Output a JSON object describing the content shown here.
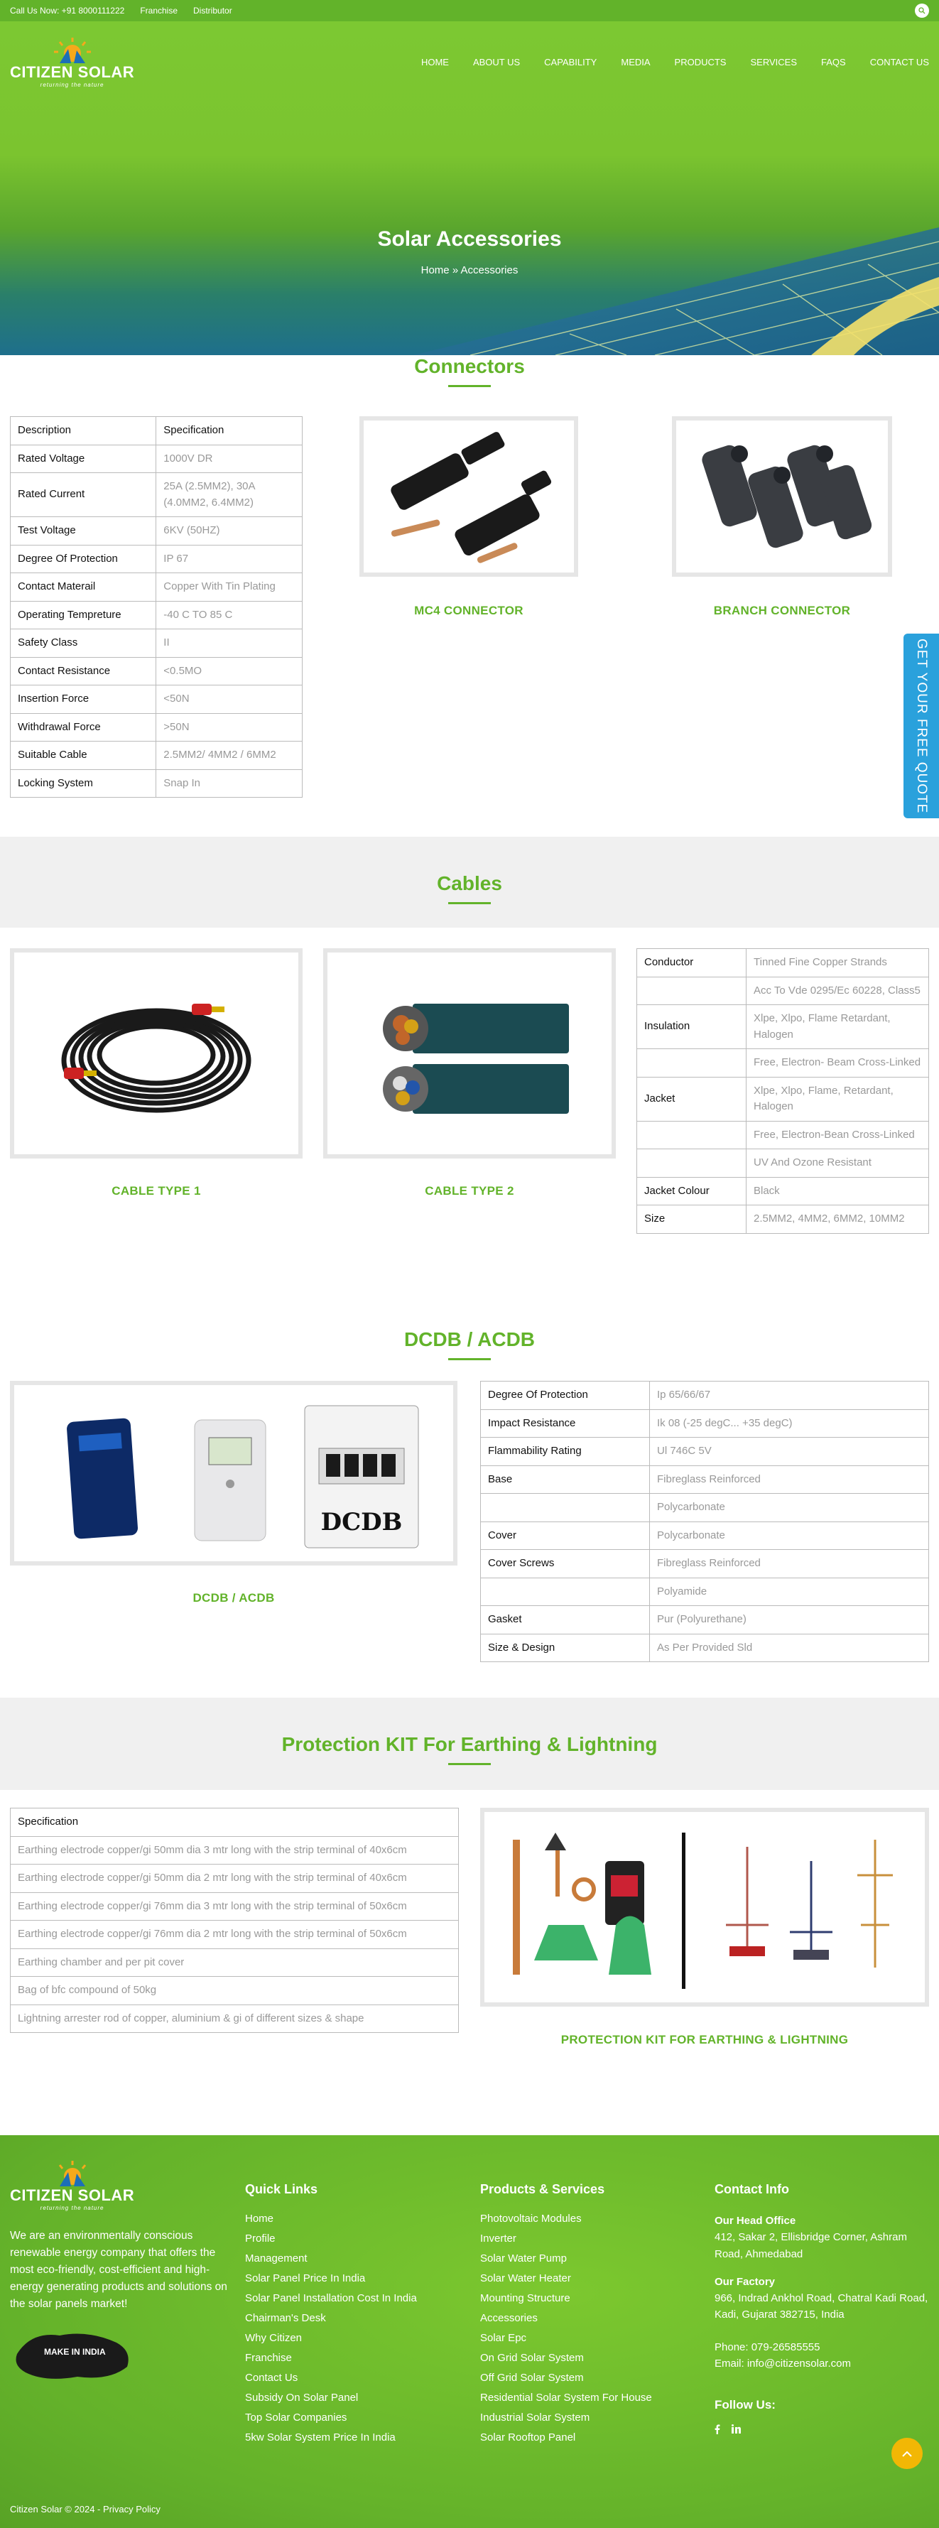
{
  "topbar": {
    "call": "Call Us Now: +91 8000111222",
    "franchise": "Franchise",
    "distributor": "Distributor"
  },
  "brand": {
    "name": "CITIZEN SOLAR",
    "tagline": "returning the nature"
  },
  "nav": [
    "HOME",
    "ABOUT US",
    "CAPABILITY",
    "MEDIA",
    "PRODUCTS",
    "SERVICES",
    "FAQS",
    "CONTACT US"
  ],
  "hero": {
    "title": "Solar Accessories",
    "crumb_home": "Home",
    "crumb_sep": "»",
    "crumb_current": "Accessories"
  },
  "quote_tab": "GET YOUR FREE QUOTE",
  "connectors": {
    "title": "Connectors",
    "table": [
      [
        "Description",
        "Specification"
      ],
      [
        "Rated Voltage",
        "1000V DR"
      ],
      [
        "Rated Current",
        "25A (2.5MM2), 30A (4.0MM2, 6.4MM2)"
      ],
      [
        "Test Voltage",
        "6KV (50HZ)"
      ],
      [
        "Degree Of Protection",
        "IP 67"
      ],
      [
        "Contact Materail",
        "Copper With Tin Plating"
      ],
      [
        "Operating Tempreture",
        "-40 C TO 85 C"
      ],
      [
        "Safety Class",
        "II"
      ],
      [
        "Contact Resistance",
        "<0.5MO"
      ],
      [
        "Insertion Force",
        "<50N"
      ],
      [
        "Withdrawal Force",
        ">50N"
      ],
      [
        "Suitable Cable",
        "2.5MM2/ 4MM2 / 6MM2"
      ],
      [
        "Locking System",
        "Snap In"
      ]
    ],
    "items": [
      "MC4 CONNECTOR",
      "BRANCH CONNECTOR"
    ]
  },
  "cables": {
    "title": "Cables",
    "items": [
      "CABLE TYPE 1",
      "CABLE TYPE 2"
    ],
    "table": [
      [
        "Conductor",
        "Tinned Fine Copper Strands"
      ],
      [
        "",
        "Acc To Vde 0295/Ec 60228, Class5"
      ],
      [
        "Insulation",
        "Xlpe, Xlpo, Flame Retardant, Halogen"
      ],
      [
        "",
        "Free, Electron- Beam Cross-Linked"
      ],
      [
        "Jacket",
        "Xlpe, Xlpo, Flame, Retardant, Halogen"
      ],
      [
        "",
        "Free, Electron-Bean Cross-Linked"
      ],
      [
        "",
        "UV And Ozone Resistant"
      ],
      [
        "Jacket Colour",
        "Black"
      ],
      [
        "Size",
        "2.5MM2, 4MM2, 6MM2, 10MM2"
      ]
    ]
  },
  "dcdb": {
    "title": "DCDB / ACDB",
    "caption": "DCDB / ACDB",
    "image_label": "DCDB",
    "table": [
      [
        "Degree Of Protection",
        "Ip 65/66/67"
      ],
      [
        "Impact Resistance",
        "Ik 08 (-25 degC... +35 degC)"
      ],
      [
        "Flammability Rating",
        "Ul 746C 5V"
      ],
      [
        "Base",
        "Fibreglass Reinforced"
      ],
      [
        "",
        "Polycarbonate"
      ],
      [
        "Cover",
        "Polycarbonate"
      ],
      [
        "Cover Screws",
        "Fibreglass Reinforced"
      ],
      [
        "",
        "Polyamide"
      ],
      [
        "Gasket",
        "Pur (Polyurethane)"
      ],
      [
        "Size & Design",
        "As Per Provided Sld"
      ]
    ]
  },
  "protection": {
    "title": "Protection KIT For Earthing & Lightning",
    "header": "Specification",
    "rows": [
      "Earthing electrode copper/gi 50mm dia 3 mtr long with the strip terminal of 40x6cm",
      "Earthing electrode copper/gi 50mm dia 2 mtr long with the strip terminal of 40x6cm",
      "Earthing electrode copper/gi 76mm dia  3 mtr long with the strip terminal of 50x6cm",
      "Earthing electrode copper/gi 76mm dia  2 mtr long with the strip terminal of 50x6cm",
      "Earthing chamber and per pit cover",
      "Bag of bfc compound of 50kg",
      "Lightning arrester rod of copper, aluminium & gi of different sizes & shape"
    ],
    "caption": "PROTECTION KIT FOR EARTHING & LIGHTNING"
  },
  "footer": {
    "about": "We are an environmentally conscious renewable energy company that offers the most eco-friendly, cost-efficient and high-energy generating products and solutions on the solar panels market!",
    "make_in_india": "MAKE IN INDIA",
    "quick_links_title": "Quick Links",
    "quick_links": [
      "Home",
      "Profile",
      "Management",
      "Solar Panel Price In India",
      "Solar Panel Installation Cost In India",
      "Chairman's Desk",
      "Why Citizen",
      "Franchise",
      "Contact Us",
      "Subsidy On Solar Panel",
      "Top Solar Companies",
      "5kw Solar System Price In India"
    ],
    "products_title": "Products & Services",
    "products": [
      "Photovoltaic Modules",
      "Inverter",
      "Solar Water Pump",
      "Solar Water Heater",
      "Mounting Structure",
      "Accessories",
      "Solar Epc",
      "On Grid Solar System",
      "Off Grid Solar System",
      "Residential Solar System For House",
      "Industrial Solar System",
      "Solar Rooftop Panel"
    ],
    "contact_title": "Contact Info",
    "head_office_label": "Our Head Office",
    "head_office": "412, Sakar 2, Ellisbridge Corner, Ashram Road, Ahmedabad",
    "factory_label": "Our Factory",
    "factory": "966, Indrad Ankhol Road, Chatral Kadi Road, Kadi, Gujarat 382715, India",
    "phone": "Phone: 079-26585555",
    "email": "Email: info@citizensolar.com",
    "follow": "Follow Us:",
    "copyright": "Citizen Solar © 2024 - Privacy Policy"
  }
}
